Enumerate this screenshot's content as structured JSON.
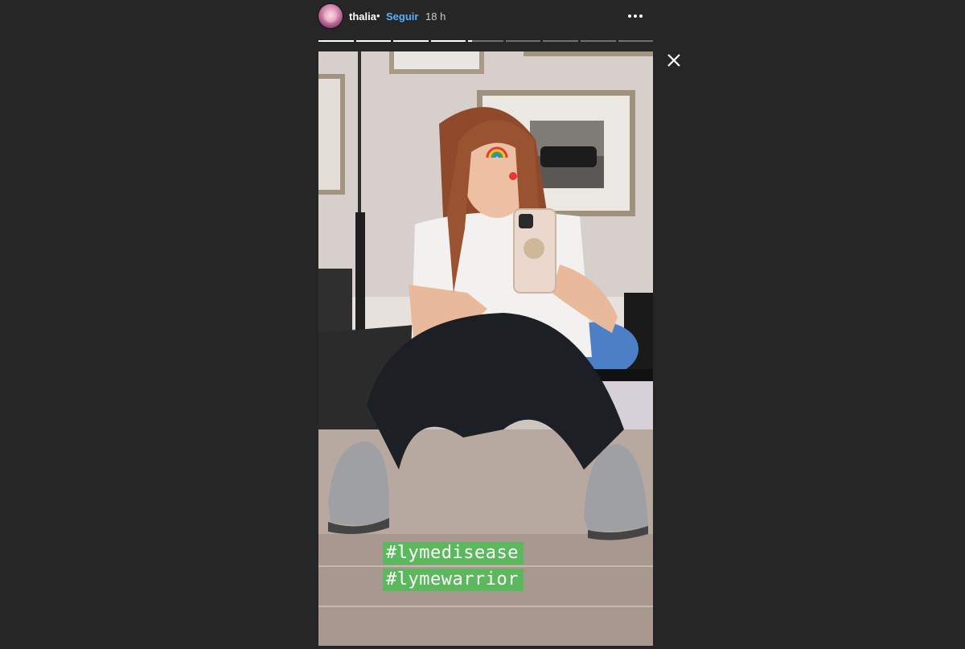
{
  "header": {
    "username": "thalia",
    "separator": "•",
    "follow_label": "Seguir",
    "time_ago": "18 h",
    "more_icon": "more-horizontal-icon",
    "avatar_icon": "profile-avatar"
  },
  "progress": {
    "segments": 9,
    "fills": [
      1,
      1,
      1,
      1,
      0.1,
      0,
      0,
      0,
      0
    ]
  },
  "story": {
    "hashtags": [
      "#lymedisease",
      "#lymewarrior"
    ],
    "tag_color": "#5bb85d"
  },
  "close_icon": "close-icon",
  "colors": {
    "background": "#262626",
    "follow": "#5ab1f7"
  }
}
